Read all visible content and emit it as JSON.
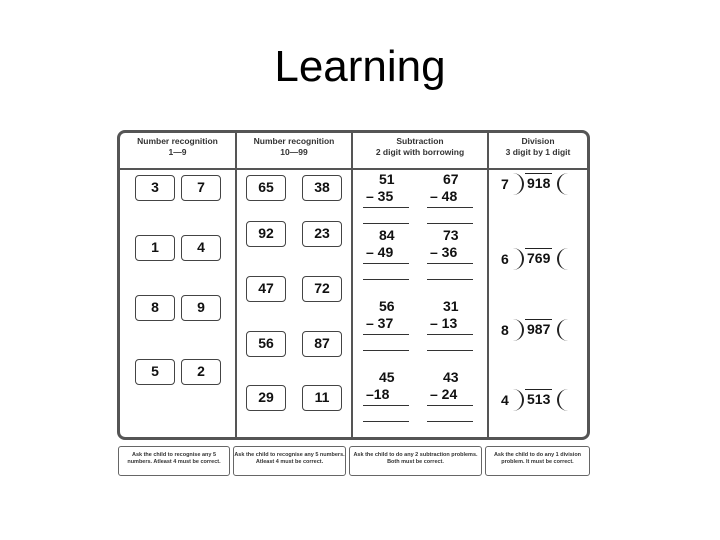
{
  "slide": {
    "title": "Learning"
  },
  "columns": [
    {
      "title": "Number recognition",
      "subtitle": "1—9"
    },
    {
      "title": "Number recognition",
      "subtitle": "10—99"
    },
    {
      "title": "Subtraction",
      "subtitle": "2 digit with borrowing"
    },
    {
      "title": "Division",
      "subtitle": "3 digit by 1 digit"
    }
  ],
  "single_digits": [
    [
      "3",
      "7"
    ],
    [
      "1",
      "4"
    ],
    [
      "8",
      "9"
    ],
    [
      "5",
      "2"
    ]
  ],
  "double_digits": [
    [
      "65",
      "38"
    ],
    [
      "92",
      "23"
    ],
    [
      "47",
      "72"
    ],
    [
      "56",
      "87"
    ],
    [
      "29",
      "11"
    ]
  ],
  "subtraction": [
    [
      {
        "top": "51",
        "bottom": "– 35"
      },
      {
        "top": "67",
        "bottom": "–  48"
      }
    ],
    [
      {
        "top": "84",
        "bottom": "– 49"
      },
      {
        "top": "73",
        "bottom": "–  36"
      }
    ],
    [
      {
        "top": "56",
        "bottom": "– 37"
      },
      {
        "top": "31",
        "bottom": "–  13"
      }
    ],
    [
      {
        "top": "45",
        "bottom": "–18"
      },
      {
        "top": "43",
        "bottom": "–  24"
      }
    ]
  ],
  "division": [
    {
      "divisor": "7",
      "dividend": "918"
    },
    {
      "divisor": "6",
      "dividend": "769"
    },
    {
      "divisor": "8",
      "dividend": "987"
    },
    {
      "divisor": "4",
      "dividend": "513"
    }
  ],
  "footers": [
    "Ask the child to recognise any 5 numbers. Atleast 4 must be correct.",
    "Ask the child to recognise any 5 numbers. Atleast 4 must be correct.",
    "Ask the child to do any 2 subtraction problems. Both must be correct.",
    "Ask the child to do any 1 division problem. It must be correct."
  ]
}
